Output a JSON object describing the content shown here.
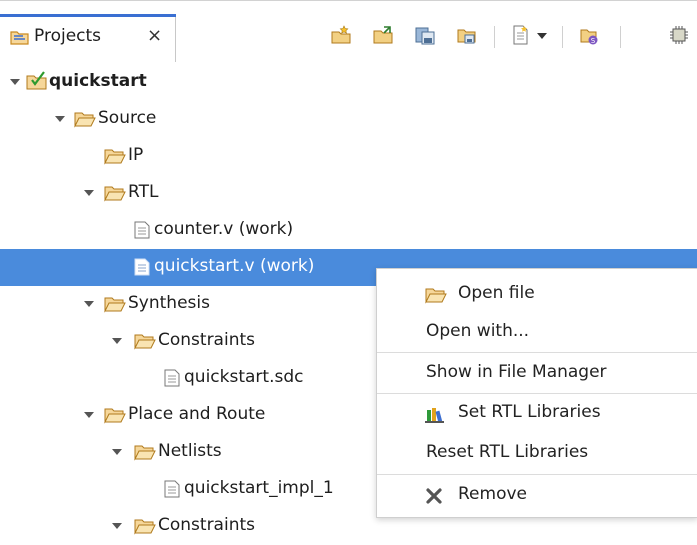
{
  "tab": {
    "label": "Projects",
    "close": "×"
  },
  "toolbar": {
    "icons": [
      "new-project-icon",
      "open-project-icon",
      "save-project-icon",
      "save-all-icon",
      "new-file-icon",
      "add-source-icon",
      "chip-icon"
    ]
  },
  "tree": {
    "root": "quickstart",
    "source": "Source",
    "ip": "IP",
    "rtl": "RTL",
    "counter": "counter.v (work)",
    "quickstart_v": "quickstart.v (work)",
    "synthesis": "Synthesis",
    "constraints": "Constraints",
    "sdc": "quickstart.sdc",
    "par": "Place and Route",
    "netlists": "Netlists",
    "impl": "quickstart_impl_1",
    "constraints2": "Constraints"
  },
  "menu": {
    "open_file": "Open file",
    "open_with": "Open with...",
    "show_in_fm": "Show in File Manager",
    "set_rtl": "Set RTL Libraries",
    "reset_rtl": "Reset RTL Libraries",
    "remove": "Remove"
  },
  "colors": {
    "selection": "#4a8bdc",
    "tab_accent": "#3a6fd2",
    "folder": "#e8a33a"
  }
}
